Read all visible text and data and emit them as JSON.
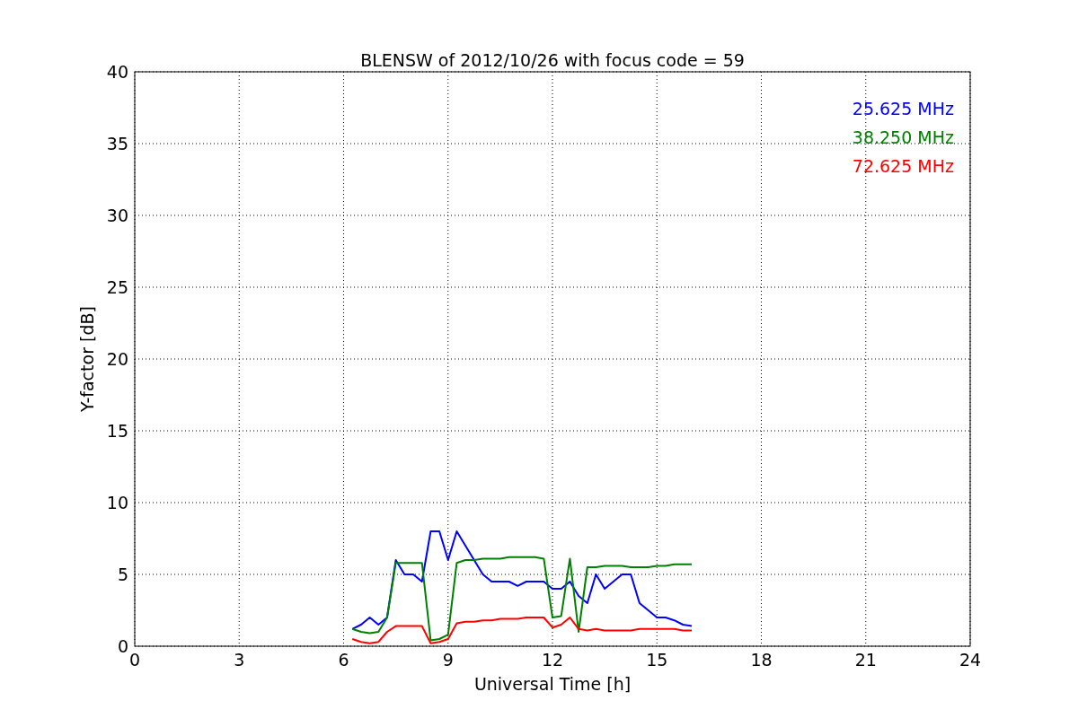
{
  "chart_data": {
    "type": "line",
    "title": "BLENSW of 2012/10/26 with focus code = 59",
    "xlabel": "Universal Time [h]",
    "ylabel": "Y-factor [dB]",
    "x": [
      6.25,
      6.5,
      6.75,
      7,
      7.25,
      7.5,
      7.75,
      8,
      8.25,
      8.5,
      8.75,
      9,
      9.25,
      9.5,
      9.75,
      10,
      10.25,
      10.5,
      10.75,
      11,
      11.25,
      11.5,
      11.75,
      12,
      12.25,
      12.5,
      12.75,
      13,
      13.25,
      13.5,
      13.75,
      14,
      14.25,
      14.5,
      14.75,
      15,
      15.25,
      15.5,
      15.75,
      16
    ],
    "series": [
      {
        "name": "25.625 MHz",
        "color": "#0000ff",
        "values": [
          1.2,
          1.5,
          2,
          1.5,
          2,
          6,
          5,
          5,
          4.5,
          8,
          8,
          6,
          8,
          7,
          6,
          5,
          4.5,
          4.5,
          4.5,
          4.2,
          4.5,
          4.5,
          4.5,
          4,
          4,
          4.5,
          3.5,
          3,
          5,
          4,
          4.5,
          5,
          5,
          3,
          2.5,
          2,
          2,
          1.8,
          1.5,
          1.4
        ]
      },
      {
        "name": "38.250 MHz",
        "color": "#008000",
        "values": [
          1.2,
          1,
          0.9,
          1,
          2,
          5.8,
          5.8,
          5.8,
          5.8,
          0.4,
          0.5,
          0.8,
          5.8,
          6,
          6,
          6.1,
          6.1,
          6.1,
          6.2,
          6.2,
          6.2,
          6.2,
          6.1,
          2,
          2.1,
          6.1,
          1,
          5.5,
          5.5,
          5.6,
          5.6,
          5.6,
          5.5,
          5.5,
          5.5,
          5.6,
          5.6,
          5.7,
          5.7,
          5.7
        ]
      },
      {
        "name": "72.625 MHz",
        "color": "#ff0000",
        "values": [
          0.5,
          0.3,
          0.2,
          0.3,
          1,
          1.4,
          1.4,
          1.4,
          1.4,
          0.2,
          0.3,
          0.5,
          1.6,
          1.7,
          1.7,
          1.8,
          1.8,
          1.9,
          1.9,
          1.9,
          2,
          2,
          2,
          1.3,
          1.5,
          2,
          1.2,
          1.1,
          1.2,
          1.1,
          1.1,
          1.1,
          1.1,
          1.2,
          1.2,
          1.2,
          1.2,
          1.2,
          1.1,
          1.1
        ]
      }
    ],
    "grid": true,
    "xlim": [
      0,
      24
    ],
    "ylim": [
      0,
      40
    ],
    "xticks": [
      0,
      3,
      6,
      9,
      12,
      15,
      18,
      21,
      24
    ],
    "yticks": [
      0,
      5,
      10,
      15,
      20,
      25,
      30,
      35,
      40
    ]
  }
}
